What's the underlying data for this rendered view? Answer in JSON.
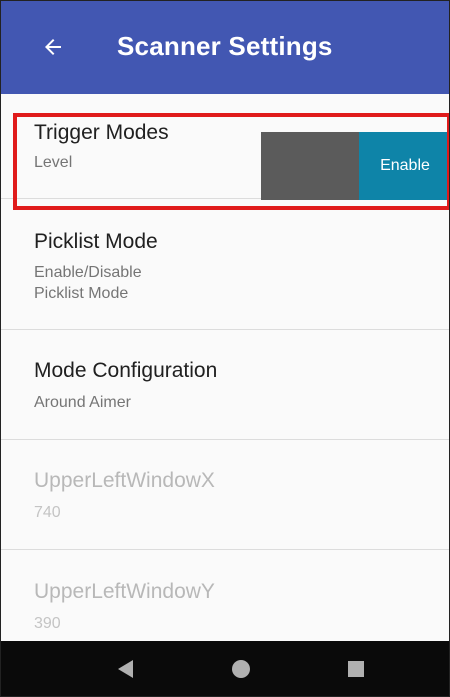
{
  "app_bar": {
    "title": "Scanner Settings",
    "back_icon": "arrow-left-icon",
    "color": "#4257b2"
  },
  "preferences": [
    {
      "title": "Trigger Modes",
      "summary": "Level",
      "enabled": true
    },
    {
      "title": "Picklist Mode",
      "summary_line1": "Enable/Disable",
      "summary_line2": "Picklist Mode",
      "enabled": true,
      "highlighted": true
    },
    {
      "title": "Mode Configuration",
      "summary": "Around Aimer",
      "enabled": true
    },
    {
      "title": "UpperLeftWindowX",
      "summary": "740",
      "enabled": false
    },
    {
      "title": "UpperLeftWindowY",
      "summary": "390",
      "enabled": false
    }
  ],
  "picklist_toggle": {
    "label": "Enable",
    "state": "on",
    "on_color": "#0e84a8",
    "off_color": "#5b5b5b"
  },
  "highlight_color": "#e01b1b",
  "nav_bar": {
    "back": "triangle-back-icon",
    "home": "circle-home-icon",
    "recents": "square-recents-icon"
  }
}
